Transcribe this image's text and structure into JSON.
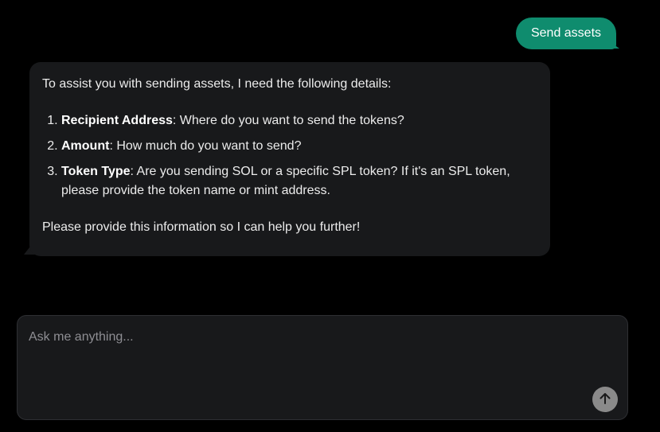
{
  "messages": {
    "user": {
      "text": "Send assets"
    },
    "assistant": {
      "intro": "To assist you with sending assets, I need the following details:",
      "items": [
        {
          "label": "Recipient Address",
          "text": ": Where do you want to send the tokens?"
        },
        {
          "label": "Amount",
          "text": ": How much do you want to send?"
        },
        {
          "label": "Token Type",
          "text": ": Are you sending SOL or a specific SPL token? If it's an SPL token, please provide the token name or mint address."
        }
      ],
      "outro": "Please provide this information so I can help you further!"
    }
  },
  "composer": {
    "placeholder": "Ask me anything...",
    "send_icon": "arrow-up-icon"
  },
  "colors": {
    "background": "#000000",
    "user_bubble": "#0f8c6e",
    "assistant_bubble": "#18191b",
    "send_button": "#8a8a8a"
  }
}
